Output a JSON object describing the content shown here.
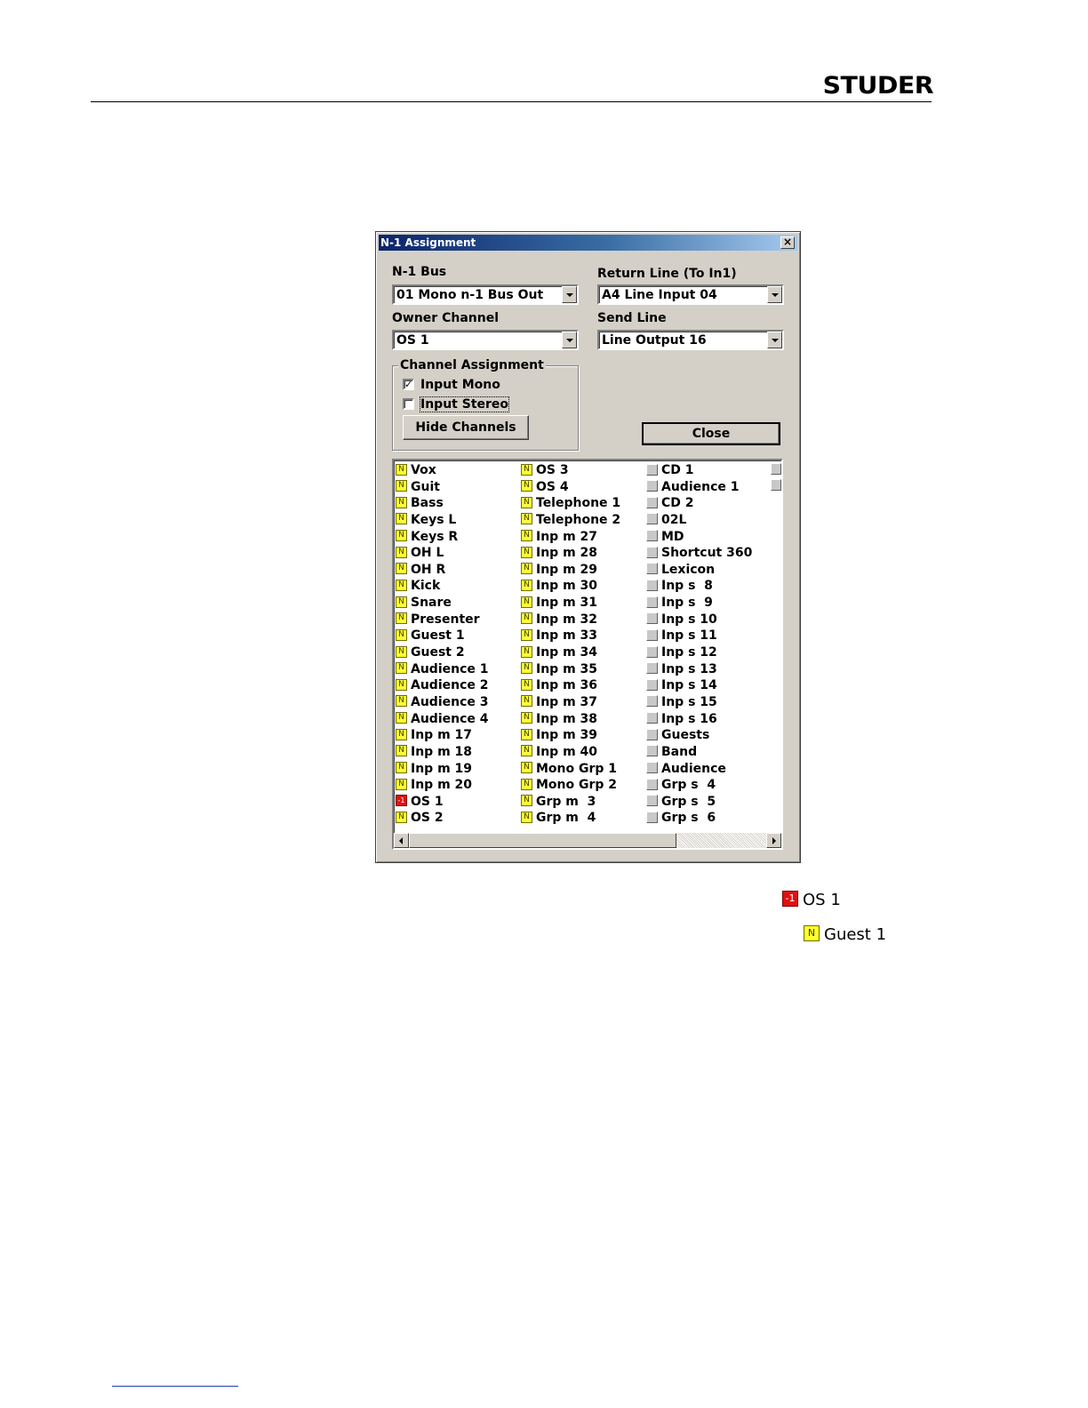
{
  "brand": "STUDER",
  "dialog": {
    "title": "N-1 Assignment",
    "n1_bus": {
      "label": "N-1 Bus",
      "value": "01 Mono n-1 Bus Out"
    },
    "return_line": {
      "label": "Return Line (To In1)",
      "value": "A4  Line Input 04"
    },
    "owner_channel": {
      "label": "Owner Channel",
      "value": "OS 1"
    },
    "send_line": {
      "label": "Send Line",
      "value": "Line Output 16"
    },
    "channel_assignment": {
      "legend": "Channel Assignment",
      "input_mono": {
        "label": "Input Mono",
        "checked": true
      },
      "input_stereo": {
        "label": "Input Stereo",
        "checked": false
      },
      "hide_channels": "Hide Channels"
    },
    "close_label": "Close",
    "channels": {
      "col1": [
        {
          "name": "Vox",
          "state": "N"
        },
        {
          "name": "Guit",
          "state": "N"
        },
        {
          "name": "Bass",
          "state": "N"
        },
        {
          "name": "Keys L",
          "state": "N"
        },
        {
          "name": "Keys R",
          "state": "N"
        },
        {
          "name": "OH L",
          "state": "N"
        },
        {
          "name": "OH R",
          "state": "N"
        },
        {
          "name": "Kick",
          "state": "N"
        },
        {
          "name": "Snare",
          "state": "N"
        },
        {
          "name": "Presenter",
          "state": "N"
        },
        {
          "name": "Guest 1",
          "state": "N"
        },
        {
          "name": "Guest 2",
          "state": "N"
        },
        {
          "name": "Audience 1",
          "state": "N"
        },
        {
          "name": "Audience 2",
          "state": "N"
        },
        {
          "name": "Audience 3",
          "state": "N"
        },
        {
          "name": "Audience 4",
          "state": "N"
        },
        {
          "name": "Inp m 17",
          "state": "N"
        },
        {
          "name": "Inp m 18",
          "state": "N"
        },
        {
          "name": "Inp m 19",
          "state": "N"
        },
        {
          "name": "Inp m 20",
          "state": "N"
        },
        {
          "name": "OS 1",
          "state": "-1"
        },
        {
          "name": "OS 2",
          "state": "N"
        }
      ],
      "col2": [
        {
          "name": "OS 3",
          "state": "N"
        },
        {
          "name": "OS 4",
          "state": "N"
        },
        {
          "name": "Telephone 1",
          "state": "N"
        },
        {
          "name": "Telephone 2",
          "state": "N"
        },
        {
          "name": "Inp m 27",
          "state": "N"
        },
        {
          "name": "Inp m 28",
          "state": "N"
        },
        {
          "name": "Inp m 29",
          "state": "N"
        },
        {
          "name": "Inp m 30",
          "state": "N"
        },
        {
          "name": "Inp m 31",
          "state": "N"
        },
        {
          "name": "Inp m 32",
          "state": "N"
        },
        {
          "name": "Inp m 33",
          "state": "N"
        },
        {
          "name": "Inp m 34",
          "state": "N"
        },
        {
          "name": "Inp m 35",
          "state": "N"
        },
        {
          "name": "Inp m 36",
          "state": "N"
        },
        {
          "name": "Inp m 37",
          "state": "N"
        },
        {
          "name": "Inp m 38",
          "state": "N"
        },
        {
          "name": "Inp m 39",
          "state": "N"
        },
        {
          "name": "Inp m 40",
          "state": "N"
        },
        {
          "name": "Mono Grp 1",
          "state": "N"
        },
        {
          "name": "Mono Grp 2",
          "state": "N"
        },
        {
          "name": "Grp m  3",
          "state": "N"
        },
        {
          "name": "Grp m  4",
          "state": "N"
        }
      ],
      "col3": [
        {
          "name": "CD 1",
          "state": ""
        },
        {
          "name": "Audience 1",
          "state": ""
        },
        {
          "name": "CD 2",
          "state": ""
        },
        {
          "name": "02L",
          "state": ""
        },
        {
          "name": "MD",
          "state": ""
        },
        {
          "name": "Shortcut 360",
          "state": ""
        },
        {
          "name": "Lexicon",
          "state": ""
        },
        {
          "name": "Inp s  8",
          "state": ""
        },
        {
          "name": "Inp s  9",
          "state": ""
        },
        {
          "name": "Inp s 10",
          "state": ""
        },
        {
          "name": "Inp s 11",
          "state": ""
        },
        {
          "name": "Inp s 12",
          "state": ""
        },
        {
          "name": "Inp s 13",
          "state": ""
        },
        {
          "name": "Inp s 14",
          "state": ""
        },
        {
          "name": "Inp s 15",
          "state": ""
        },
        {
          "name": "Inp s 16",
          "state": ""
        },
        {
          "name": "Guests",
          "state": ""
        },
        {
          "name": "Band",
          "state": ""
        },
        {
          "name": "Audience",
          "state": ""
        },
        {
          "name": "Grp s  4",
          "state": ""
        },
        {
          "name": "Grp s  5",
          "state": ""
        },
        {
          "name": "Grp s  6",
          "state": ""
        }
      ]
    }
  },
  "legend_examples": [
    {
      "state": "-1",
      "name": "OS 1"
    },
    {
      "state": "N",
      "name": "Guest 1"
    }
  ],
  "colors": {
    "title_start": "#0a246a",
    "title_end": "#a6caf0",
    "dialog_bg": "#d4d0c8",
    "n_indicator": "#ffff33",
    "owner_indicator": "#e01010"
  }
}
